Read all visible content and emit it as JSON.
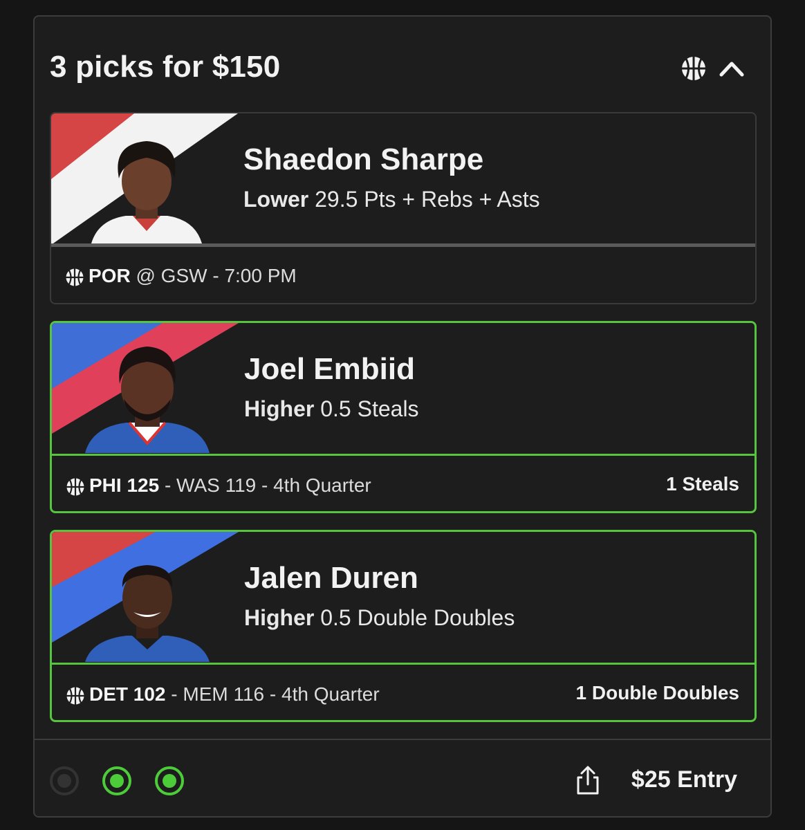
{
  "header": {
    "title": "3 picks for $150",
    "sport_icon": "basketball-icon",
    "collapse_icon": "chevron-up-icon"
  },
  "picks": [
    {
      "player": "Shaedon Sharpe",
      "direction": "Lower",
      "line": "29.5 Pts + Rebs + Asts",
      "team": "POR",
      "game_rest": "@ GSW - 7:00 PM",
      "result": "",
      "status": "pending",
      "stripe_colors": [
        "#d64545",
        "#f2f2f2"
      ]
    },
    {
      "player": "Joel Embiid",
      "direction": "Higher",
      "line": "0.5 Steals",
      "team": "PHI 125",
      "game_rest": "- WAS 119 - 4th Quarter",
      "result": "1 Steals",
      "status": "hit",
      "stripe_colors": [
        "#3f6fd6",
        "#e0405a"
      ]
    },
    {
      "player": "Jalen Duren",
      "direction": "Higher",
      "line": "0.5 Double Doubles",
      "team": "DET 102",
      "game_rest": "- MEM 116 - 4th Quarter",
      "result": "1 Double Doubles",
      "status": "hit",
      "stripe_colors": [
        "#d64545",
        "#3f6fe0"
      ]
    }
  ],
  "footer": {
    "entry": "$25 Entry",
    "share_icon": "share-icon",
    "pick_status": [
      "pending",
      "hit",
      "hit"
    ]
  },
  "colors": {
    "win_green": "#56c43f",
    "background": "#1d1d1d",
    "border": "#3c3c3c"
  }
}
